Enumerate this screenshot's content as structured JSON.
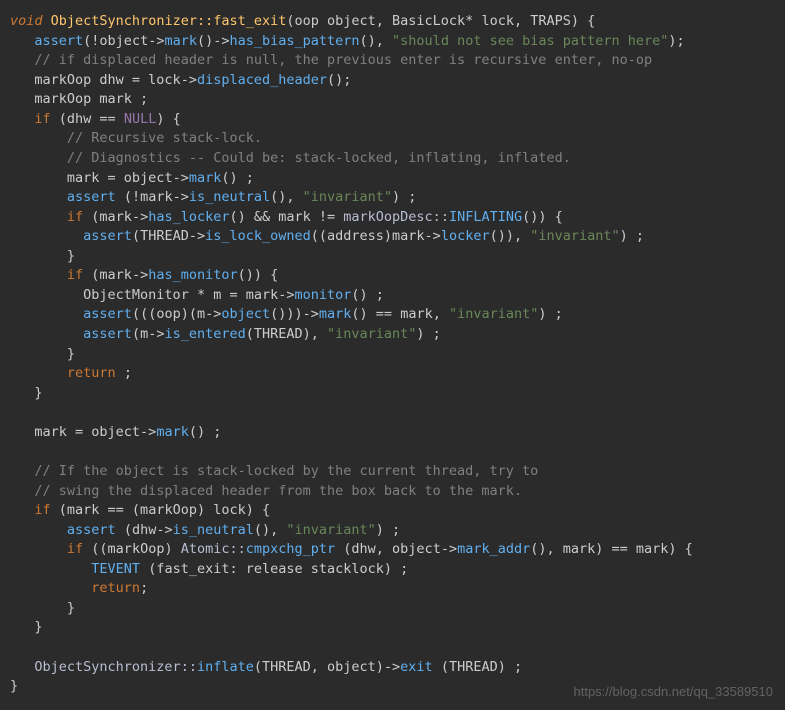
{
  "watermark": "https://blog.csdn.net/qq_33589510",
  "code": {
    "l1": {
      "ret": "void",
      "cls": "ObjectSynchronizer::",
      "fn": "fast_exit",
      "sig": "(oop object, BasicLock* lock, TRAPS) {"
    },
    "l2": {
      "fn": "assert",
      "arg1": "(!object->",
      "m1": "mark",
      "mid1": "()->",
      "m2": "has_bias_pattern",
      "mid2": "(), ",
      "str": "\"should not see bias pattern here\"",
      "end": ");"
    },
    "l3": {
      "com": "// if displaced header is null, the previous enter is recursive enter, no-op"
    },
    "l4": {
      "pre": "markOop dhw = lock->",
      "m": "displaced_header",
      "end": "();"
    },
    "l5": {
      "txt": "markOop mark ;"
    },
    "l6": {
      "kw": "if",
      "pre": " (dhw == ",
      "c": "NULL",
      "end": ") {"
    },
    "l7": {
      "com": "// Recursive stack-lock."
    },
    "l8": {
      "com": "// Diagnostics -- Could be: stack-locked, inflating, inflated."
    },
    "l9": {
      "pre": "mark = object->",
      "m": "mark",
      "end": "() ;"
    },
    "l10": {
      "fn": "assert",
      "pre": " (!mark->",
      "m": "is_neutral",
      "mid": "(), ",
      "str": "\"invariant\"",
      "end": ") ;"
    },
    "l11": {
      "kw": "if",
      "pre": " (mark->",
      "m": "has_locker",
      "mid": "() && mark != ",
      "ns": "markOopDesc::",
      "fn2": "INFLATING",
      "end": "()) {"
    },
    "l12": {
      "fn": "assert",
      "pre": "(THREAD->",
      "m": "is_lock_owned",
      "mid": "((address)mark->",
      "m2": "locker",
      "mid2": "()), ",
      "str": "\"invariant\"",
      "end": ") ;"
    },
    "l13": {
      "txt": "}"
    },
    "l14": {
      "kw": "if",
      "pre": " (mark->",
      "m": "has_monitor",
      "end": "()) {"
    },
    "l15": {
      "pre": "ObjectMonitor * m = mark->",
      "m": "monitor",
      "end": "() ;"
    },
    "l16": {
      "fn": "assert",
      "pre": "(((oop)(m->",
      "m": "object",
      "mid": "()))->",
      "m2": "mark",
      "mid2": "() == mark, ",
      "str": "\"invariant\"",
      "end": ") ;"
    },
    "l17": {
      "fn": "assert",
      "pre": "(m->",
      "m": "is_entered",
      "mid": "(THREAD), ",
      "str": "\"invariant\"",
      "end": ") ;"
    },
    "l18": {
      "txt": "}"
    },
    "l19": {
      "kw": "return",
      "end": " ;"
    },
    "l20": {
      "txt": "}"
    },
    "l21": {
      "pre": "mark = object->",
      "m": "mark",
      "end": "() ;"
    },
    "l22": {
      "com": "// If the object is stack-locked by the current thread, try to"
    },
    "l23": {
      "com": "// swing the displaced header from the box back to the mark."
    },
    "l24": {
      "kw": "if",
      "txt": " (mark == (markOop) lock) {"
    },
    "l25": {
      "fn": "assert",
      "pre": " (dhw->",
      "m": "is_neutral",
      "mid": "(), ",
      "str": "\"invariant\"",
      "end": ") ;"
    },
    "l26": {
      "kw": "if",
      "pre": " ((markOop) ",
      "ns": "Atomic::",
      "fn2": "cmpxchg_ptr",
      "mid": " (dhw, object->",
      "m": "mark_addr",
      "end": "(), mark) == mark) {"
    },
    "l27": {
      "fn": "TEVENT",
      "txt": " (fast_exit: release stacklock) ;"
    },
    "l28": {
      "kw": "return",
      "end": ";"
    },
    "l29": {
      "txt": "}"
    },
    "l30": {
      "txt": "}"
    },
    "l31": {
      "ns": "ObjectSynchronizer::",
      "fn": "inflate",
      "mid": "(THREAD, object)->",
      "m": "exit",
      "end": " (THREAD) ;"
    },
    "l32": {
      "txt": "}"
    }
  }
}
